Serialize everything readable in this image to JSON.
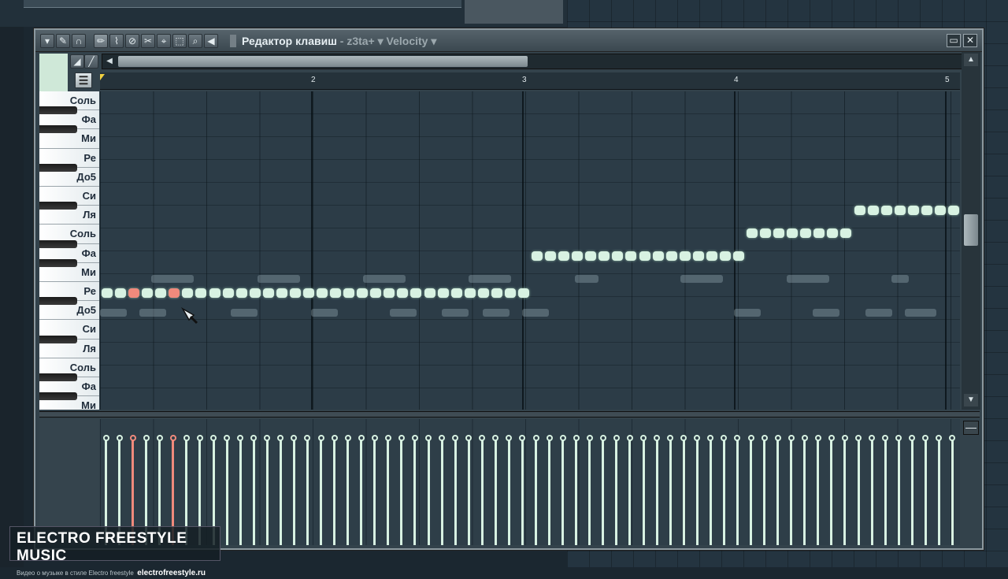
{
  "window": {
    "title": "Редактор клавиш",
    "title_separator": " - ",
    "channel": "z3ta+",
    "target": "Velocity",
    "close_label": "✕",
    "maximize_label": "▭"
  },
  "ruler": {
    "bars": [
      "2",
      "3",
      "4",
      "5"
    ]
  },
  "keys": [
    {
      "label": "Соль"
    },
    {
      "label": "Фа"
    },
    {
      "label": "Ми"
    },
    {
      "label": "Ре"
    },
    {
      "label": "До5"
    },
    {
      "label": "Си"
    },
    {
      "label": "Ля"
    },
    {
      "label": "Соль"
    },
    {
      "label": "Фа"
    },
    {
      "label": "Ми"
    },
    {
      "label": "Ре"
    },
    {
      "label": "До5"
    },
    {
      "label": "Си"
    },
    {
      "label": "Ля"
    },
    {
      "label": "Соль"
    },
    {
      "label": "Фа"
    },
    {
      "label": "Ми"
    }
  ],
  "notes": {
    "steps_per_bar": 16,
    "total_steps": 64,
    "sequences": [
      {
        "pitch_row": "Ре",
        "start_step": 0,
        "end_step": 32
      },
      {
        "pitch_row": "Фа",
        "start_step": 32,
        "end_step": 48
      },
      {
        "pitch_row": "Соль",
        "start_step": 48,
        "end_step": 56
      },
      {
        "pitch_row": "Ля",
        "start_step": 56,
        "end_step": 64
      }
    ],
    "selected_steps": [
      2,
      5
    ]
  },
  "velocity": {
    "level": 0.85,
    "count": 64,
    "selected_steps": [
      2,
      5
    ]
  },
  "watermark": {
    "title": "ELECTRO FREESTYLE MUSIC",
    "subtitle": "Видео о музыке в стиле Electro freestyle",
    "url": "electrofreestyle.ru"
  },
  "colors": {
    "note": "#d8f2e2",
    "note_selected": "#f08a7c",
    "grid_bg": "#2c3c47"
  }
}
